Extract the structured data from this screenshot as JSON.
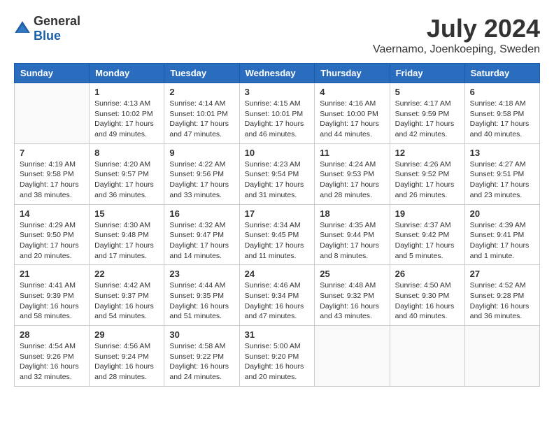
{
  "logo": {
    "text_general": "General",
    "text_blue": "Blue"
  },
  "title": {
    "month_year": "July 2024",
    "location": "Vaernamo, Joenkoeping, Sweden"
  },
  "days_of_week": [
    "Sunday",
    "Monday",
    "Tuesday",
    "Wednesday",
    "Thursday",
    "Friday",
    "Saturday"
  ],
  "weeks": [
    [
      {
        "day": "",
        "info": ""
      },
      {
        "day": "1",
        "info": "Sunrise: 4:13 AM\nSunset: 10:02 PM\nDaylight: 17 hours and 49 minutes."
      },
      {
        "day": "2",
        "info": "Sunrise: 4:14 AM\nSunset: 10:01 PM\nDaylight: 17 hours and 47 minutes."
      },
      {
        "day": "3",
        "info": "Sunrise: 4:15 AM\nSunset: 10:01 PM\nDaylight: 17 hours and 46 minutes."
      },
      {
        "day": "4",
        "info": "Sunrise: 4:16 AM\nSunset: 10:00 PM\nDaylight: 17 hours and 44 minutes."
      },
      {
        "day": "5",
        "info": "Sunrise: 4:17 AM\nSunset: 9:59 PM\nDaylight: 17 hours and 42 minutes."
      },
      {
        "day": "6",
        "info": "Sunrise: 4:18 AM\nSunset: 9:58 PM\nDaylight: 17 hours and 40 minutes."
      }
    ],
    [
      {
        "day": "7",
        "info": "Sunrise: 4:19 AM\nSunset: 9:58 PM\nDaylight: 17 hours and 38 minutes."
      },
      {
        "day": "8",
        "info": "Sunrise: 4:20 AM\nSunset: 9:57 PM\nDaylight: 17 hours and 36 minutes."
      },
      {
        "day": "9",
        "info": "Sunrise: 4:22 AM\nSunset: 9:56 PM\nDaylight: 17 hours and 33 minutes."
      },
      {
        "day": "10",
        "info": "Sunrise: 4:23 AM\nSunset: 9:54 PM\nDaylight: 17 hours and 31 minutes."
      },
      {
        "day": "11",
        "info": "Sunrise: 4:24 AM\nSunset: 9:53 PM\nDaylight: 17 hours and 28 minutes."
      },
      {
        "day": "12",
        "info": "Sunrise: 4:26 AM\nSunset: 9:52 PM\nDaylight: 17 hours and 26 minutes."
      },
      {
        "day": "13",
        "info": "Sunrise: 4:27 AM\nSunset: 9:51 PM\nDaylight: 17 hours and 23 minutes."
      }
    ],
    [
      {
        "day": "14",
        "info": "Sunrise: 4:29 AM\nSunset: 9:50 PM\nDaylight: 17 hours and 20 minutes."
      },
      {
        "day": "15",
        "info": "Sunrise: 4:30 AM\nSunset: 9:48 PM\nDaylight: 17 hours and 17 minutes."
      },
      {
        "day": "16",
        "info": "Sunrise: 4:32 AM\nSunset: 9:47 PM\nDaylight: 17 hours and 14 minutes."
      },
      {
        "day": "17",
        "info": "Sunrise: 4:34 AM\nSunset: 9:45 PM\nDaylight: 17 hours and 11 minutes."
      },
      {
        "day": "18",
        "info": "Sunrise: 4:35 AM\nSunset: 9:44 PM\nDaylight: 17 hours and 8 minutes."
      },
      {
        "day": "19",
        "info": "Sunrise: 4:37 AM\nSunset: 9:42 PM\nDaylight: 17 hours and 5 minutes."
      },
      {
        "day": "20",
        "info": "Sunrise: 4:39 AM\nSunset: 9:41 PM\nDaylight: 17 hours and 1 minute."
      }
    ],
    [
      {
        "day": "21",
        "info": "Sunrise: 4:41 AM\nSunset: 9:39 PM\nDaylight: 16 hours and 58 minutes."
      },
      {
        "day": "22",
        "info": "Sunrise: 4:42 AM\nSunset: 9:37 PM\nDaylight: 16 hours and 54 minutes."
      },
      {
        "day": "23",
        "info": "Sunrise: 4:44 AM\nSunset: 9:35 PM\nDaylight: 16 hours and 51 minutes."
      },
      {
        "day": "24",
        "info": "Sunrise: 4:46 AM\nSunset: 9:34 PM\nDaylight: 16 hours and 47 minutes."
      },
      {
        "day": "25",
        "info": "Sunrise: 4:48 AM\nSunset: 9:32 PM\nDaylight: 16 hours and 43 minutes."
      },
      {
        "day": "26",
        "info": "Sunrise: 4:50 AM\nSunset: 9:30 PM\nDaylight: 16 hours and 40 minutes."
      },
      {
        "day": "27",
        "info": "Sunrise: 4:52 AM\nSunset: 9:28 PM\nDaylight: 16 hours and 36 minutes."
      }
    ],
    [
      {
        "day": "28",
        "info": "Sunrise: 4:54 AM\nSunset: 9:26 PM\nDaylight: 16 hours and 32 minutes."
      },
      {
        "day": "29",
        "info": "Sunrise: 4:56 AM\nSunset: 9:24 PM\nDaylight: 16 hours and 28 minutes."
      },
      {
        "day": "30",
        "info": "Sunrise: 4:58 AM\nSunset: 9:22 PM\nDaylight: 16 hours and 24 minutes."
      },
      {
        "day": "31",
        "info": "Sunrise: 5:00 AM\nSunset: 9:20 PM\nDaylight: 16 hours and 20 minutes."
      },
      {
        "day": "",
        "info": ""
      },
      {
        "day": "",
        "info": ""
      },
      {
        "day": "",
        "info": ""
      }
    ]
  ]
}
